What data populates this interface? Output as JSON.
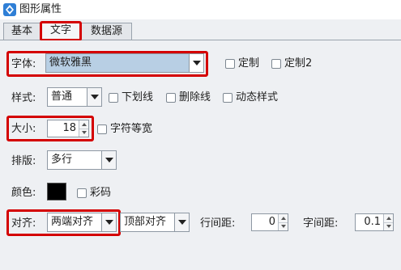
{
  "window": {
    "title": "图形属性"
  },
  "tabs": [
    {
      "label": "基本"
    },
    {
      "label": "文字"
    },
    {
      "label": "数据源"
    }
  ],
  "font": {
    "label": "字体:",
    "value": "微软雅黑",
    "custom_label": "定制",
    "custom2_label": "定制2"
  },
  "style": {
    "label": "样式:",
    "value": "普通",
    "underline_label": "下划线",
    "strikethrough_label": "删除线",
    "dynamic_label": "动态样式"
  },
  "size": {
    "label": "大小:",
    "value": "18",
    "monospace_label": "字符等宽"
  },
  "layout": {
    "label": "排版:",
    "value": "多行"
  },
  "color": {
    "label": "颜色:",
    "swatch": "#000000",
    "colorcode_label": "彩码"
  },
  "align": {
    "label": "对齐:",
    "horizontal_value": "两端对齐",
    "vertical_value": "顶部对齐",
    "line_spacing_label": "行间距:",
    "line_spacing_value": "0",
    "char_spacing_label": "字间距:",
    "char_spacing_value": "0.1"
  },
  "colors": {
    "highlight": "#d40000",
    "font_selected_bg": "#b8cfe4"
  }
}
